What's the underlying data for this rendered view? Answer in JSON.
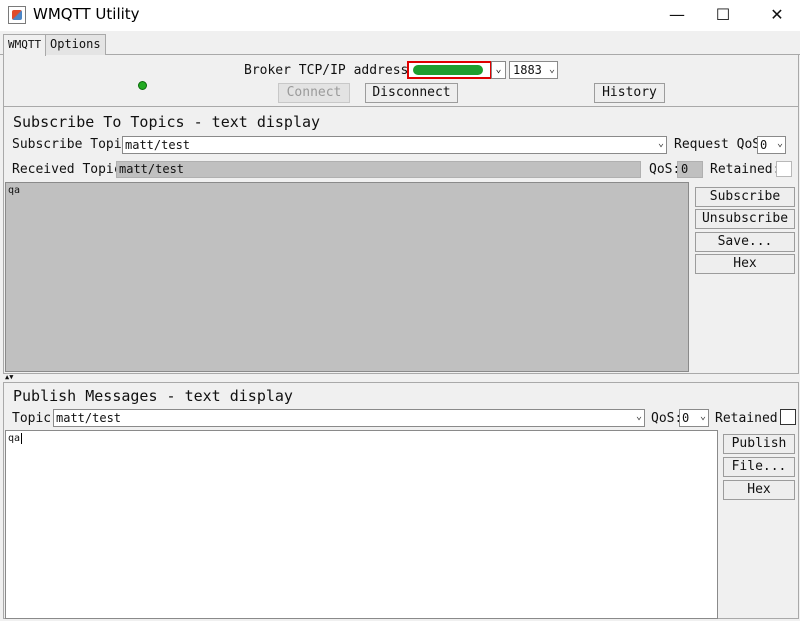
{
  "window": {
    "title": "WMQTT Utility",
    "minimize_glyph": "—",
    "maximize_glyph": "☐",
    "close_glyph": "✕"
  },
  "tabs": [
    {
      "label": "WMQTT"
    },
    {
      "label": "Options"
    }
  ],
  "broker": {
    "address_label": "Broker TCP/IP address:",
    "address_value": "",
    "port_value": "1883",
    "status_color": "#22aa22",
    "connect_label": "Connect",
    "disconnect_label": "Disconnect",
    "history_label": "History"
  },
  "subscribe": {
    "title": "Subscribe To Topics - text display",
    "topic_label": "Subscribe Topic:",
    "topic_value": "matt/test",
    "request_qos_label": "Request QoS:",
    "request_qos_value": "0",
    "received_topic_label": "Received Topic:",
    "received_topic_value": "matt/test",
    "qos_label": "QoS:",
    "qos_value": "0",
    "retained_label": "Retained:",
    "message_text": "qa",
    "buttons": {
      "subscribe": "Subscribe",
      "unsubscribe": "Unsubscribe",
      "save": "Save...",
      "hex": "Hex"
    }
  },
  "publish": {
    "title": "Publish Messages - text display",
    "topic_label": "Topic:",
    "topic_value": "matt/test",
    "qos_label": "QoS:",
    "qos_value": "0",
    "retained_label": "Retained:",
    "message_text": "qa",
    "buttons": {
      "publish": "Publish",
      "file": "File...",
      "hex": "Hex"
    }
  },
  "colors": {
    "redacted_field_border": "#e00000",
    "redacted_field_fill": "#1e9e2e",
    "readonly_area": "#c0c0c0"
  }
}
